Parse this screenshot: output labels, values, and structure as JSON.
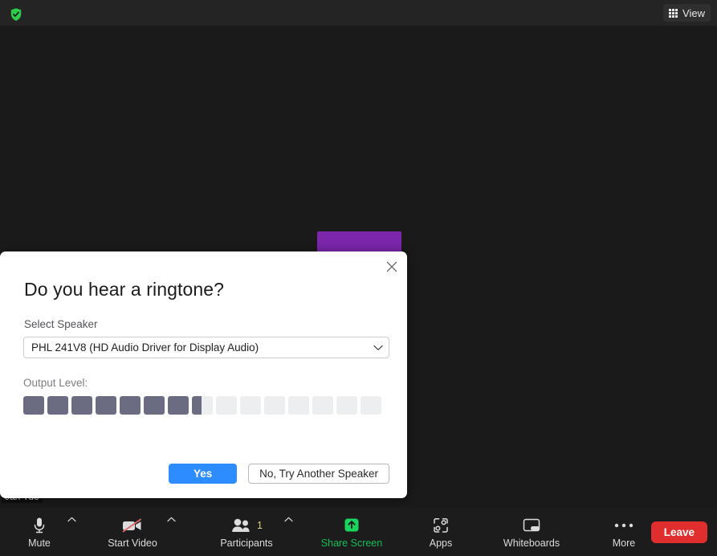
{
  "topbar": {
    "shield_icon": "shield-check-icon",
    "view_button": {
      "label": "View",
      "icon": "grid-icon"
    }
  },
  "stage": {
    "participant_tile": {
      "avatar_color": "#7b26ab",
      "name": "Jan Tuo"
    }
  },
  "dialog": {
    "title": "Do you hear a ringtone?",
    "close_icon": "close-icon",
    "speaker": {
      "label": "Select Speaker",
      "selected": "PHL 241V8 (HD Audio Driver for Display Audio)",
      "caret_icon": "chevron-down-icon"
    },
    "output_level": {
      "label": "Output Level:",
      "total_segments": 15,
      "filled_segments": 7,
      "partial_fill_percent": 45,
      "filled_color": "#6b6b81",
      "empty_color": "#edeef0"
    },
    "buttons": {
      "confirm": "Yes",
      "decline": "No, Try Another Speaker",
      "confirm_color": "#2d8cff"
    }
  },
  "toolbar": {
    "items": [
      {
        "label": "Mute",
        "icon": "microphone-icon",
        "has_caret": true
      },
      {
        "label": "Start Video",
        "icon": "video-off-icon",
        "has_caret": true
      },
      {
        "label": "Participants",
        "icon": "participants-icon",
        "has_caret": true,
        "count": "1"
      },
      {
        "label": "Share Screen",
        "icon": "share-screen-icon",
        "has_caret": false,
        "accent": "#0fbd58"
      },
      {
        "label": "Apps",
        "icon": "apps-icon",
        "has_caret": false
      },
      {
        "label": "Whiteboards",
        "icon": "whiteboard-icon",
        "has_caret": false
      },
      {
        "label": "More",
        "icon": "more-dots-icon",
        "has_caret": false
      }
    ],
    "leave_button": {
      "label": "Leave",
      "color": "#e02d2d"
    }
  }
}
